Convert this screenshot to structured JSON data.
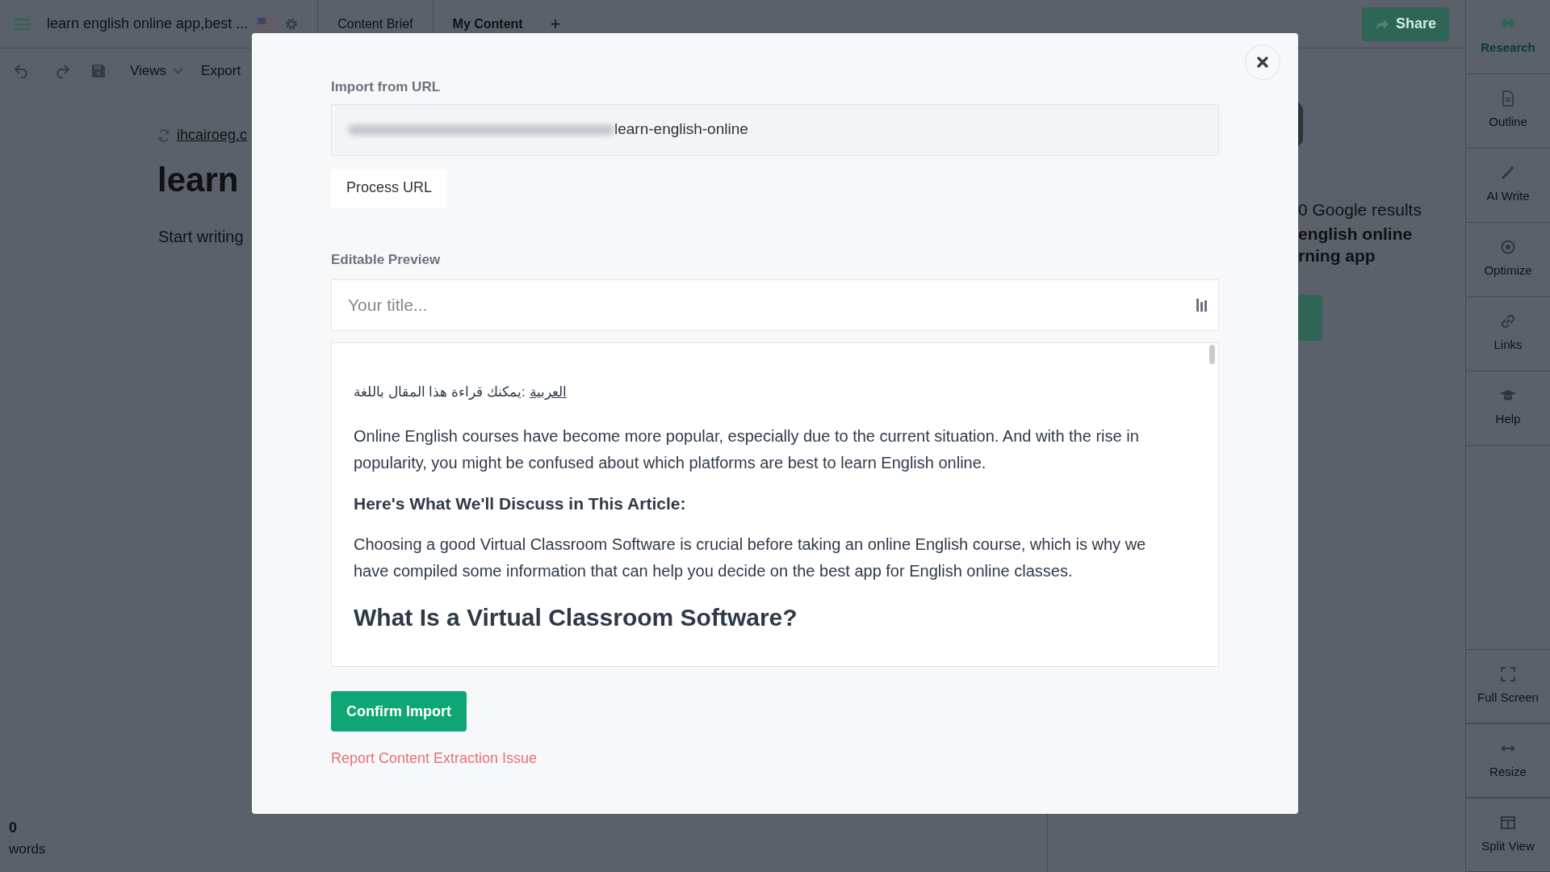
{
  "top_bar": {
    "document_title": "learn english online app,best ...",
    "tabs": [
      {
        "label": "Content Brief",
        "selected": false
      },
      {
        "label": "My Content",
        "selected": true
      }
    ],
    "add_tab": "+",
    "share_button": "Share"
  },
  "toolbar": {
    "views": "Views",
    "export": "Export"
  },
  "editor": {
    "source_link": "ihcairoeg.c",
    "title": "learn",
    "body_hint": "Start writing"
  },
  "word_count": {
    "value": "0",
    "label": "words"
  },
  "research_panel": {
    "results_text": "0 Google results",
    "keyword_lines": [
      "english online",
      "rning app"
    ]
  },
  "right_rail": [
    {
      "label": "Research",
      "selected": true
    },
    {
      "label": "Outline",
      "selected": false
    },
    {
      "label": "AI Write",
      "selected": false
    },
    {
      "label": "Optimize",
      "selected": false
    },
    {
      "label": "Links",
      "selected": false
    },
    {
      "label": "Help",
      "selected": false
    },
    {
      "label": "Full Screen",
      "selected": false
    },
    {
      "label": "Resize",
      "selected": false
    },
    {
      "label": "Split View",
      "selected": false
    }
  ],
  "modal": {
    "url_label": "Import from URL",
    "url_value": "learn-english-online",
    "process_button": "Process URL",
    "preview_label": "Editable Preview",
    "title_placeholder": "Your title...",
    "content": [
      {
        "kind": "rtl_note",
        "link": "العربية",
        "text": ":يمكنك قراءة هذا المقال باللغة"
      },
      {
        "kind": "paragraph",
        "text": "Online English courses have become more popular, especially due to the current situation. And with the rise in popularity, you might be confused about which platforms are best to learn English online."
      },
      {
        "kind": "subheading",
        "text": "Here's What We'll Discuss in This Article:"
      },
      {
        "kind": "paragraph",
        "text": "Choosing a good Virtual Classroom Software is crucial before taking an online English course, which is why we have compiled some information that can help you decide on the best app for English online classes."
      },
      {
        "kind": "heading",
        "text": "What Is a Virtual Classroom Software?"
      }
    ],
    "confirm_button": "Confirm Import",
    "report_link": "Report Content Extraction Issue"
  }
}
